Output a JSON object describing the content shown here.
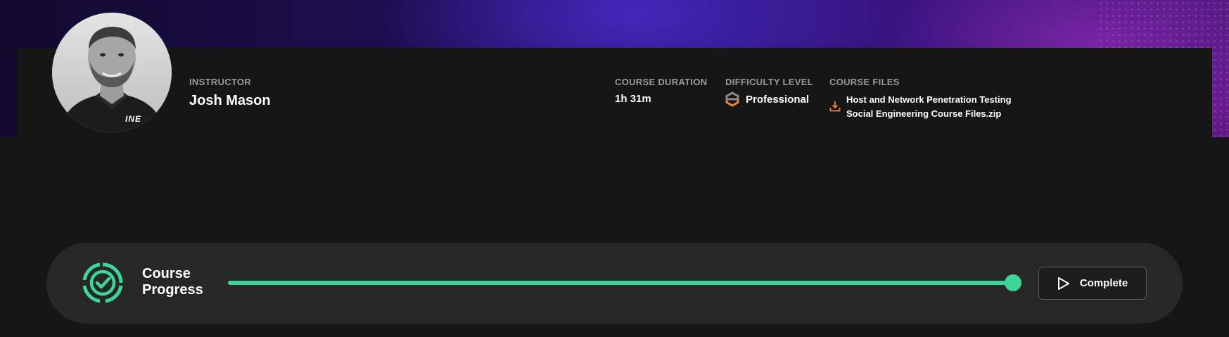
{
  "course_info": {
    "instructor": {
      "label": "INSTRUCTOR",
      "name": "Josh Mason",
      "avatar_badge": "INE"
    },
    "duration": {
      "label": "COURSE DURATION",
      "value": "1h 31m"
    },
    "difficulty": {
      "label": "DIFFICULTY LEVEL",
      "value": "Professional",
      "icon": "hexagon-icon",
      "icon_color": "#f0843c"
    },
    "files": {
      "label": "COURSE FILES",
      "file_name": "Host and Network Penetration Testing Social Engineering Course Files.zip",
      "icon": "download-icon",
      "icon_color": "#f0843c"
    }
  },
  "progress": {
    "title": "Course Progress",
    "icon": "check-circle-icon",
    "percent": 100,
    "accent_color": "#3dd598",
    "button_label": "Complete",
    "button_icon": "play-icon"
  }
}
